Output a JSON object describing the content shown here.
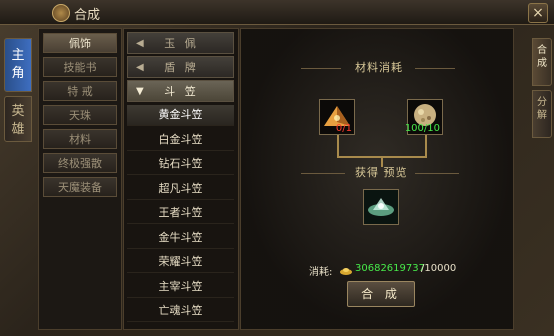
{
  "window": {
    "title": "合成",
    "close_label": "×"
  },
  "left_tabs": [
    {
      "label_top": "主",
      "label_bottom": "角",
      "active": true
    },
    {
      "label_top": "英",
      "label_bottom": "雄",
      "active": false
    }
  ],
  "right_tabs": [
    {
      "label_top": "合",
      "label_bottom": "成",
      "active": true
    },
    {
      "label_top": "分",
      "label_bottom": "解",
      "active": false
    }
  ],
  "categories": [
    "佩饰",
    "技能书",
    "特 戒",
    "天珠",
    "材料",
    "终极强散",
    "天魔装备"
  ],
  "sub_headers": [
    {
      "label": "玉 佩",
      "arrow": "◀"
    },
    {
      "label": "盾 牌",
      "arrow": "◀"
    },
    {
      "label": "斗 笠",
      "arrow": "▼"
    }
  ],
  "items": [
    "黄金斗笠",
    "白金斗笠",
    "钻石斗笠",
    "超凡斗笠",
    "王者斗笠",
    "金牛斗笠",
    "荣耀斗笠",
    "主宰斗笠",
    "亡魂斗笠"
  ],
  "main": {
    "materials_title": "材料消耗",
    "preview_title": "获得 预览",
    "material_1_count": "0/1",
    "material_2_count": "100/10",
    "cost_label": "消耗:",
    "cost_value": "30682619737",
    "cost_required": "/10000",
    "craft_button": "合 成"
  },
  "colors": {
    "insufficient": "#ff3b2e",
    "sufficient": "#47e84a",
    "accent_blue": "#3e6ec0"
  }
}
